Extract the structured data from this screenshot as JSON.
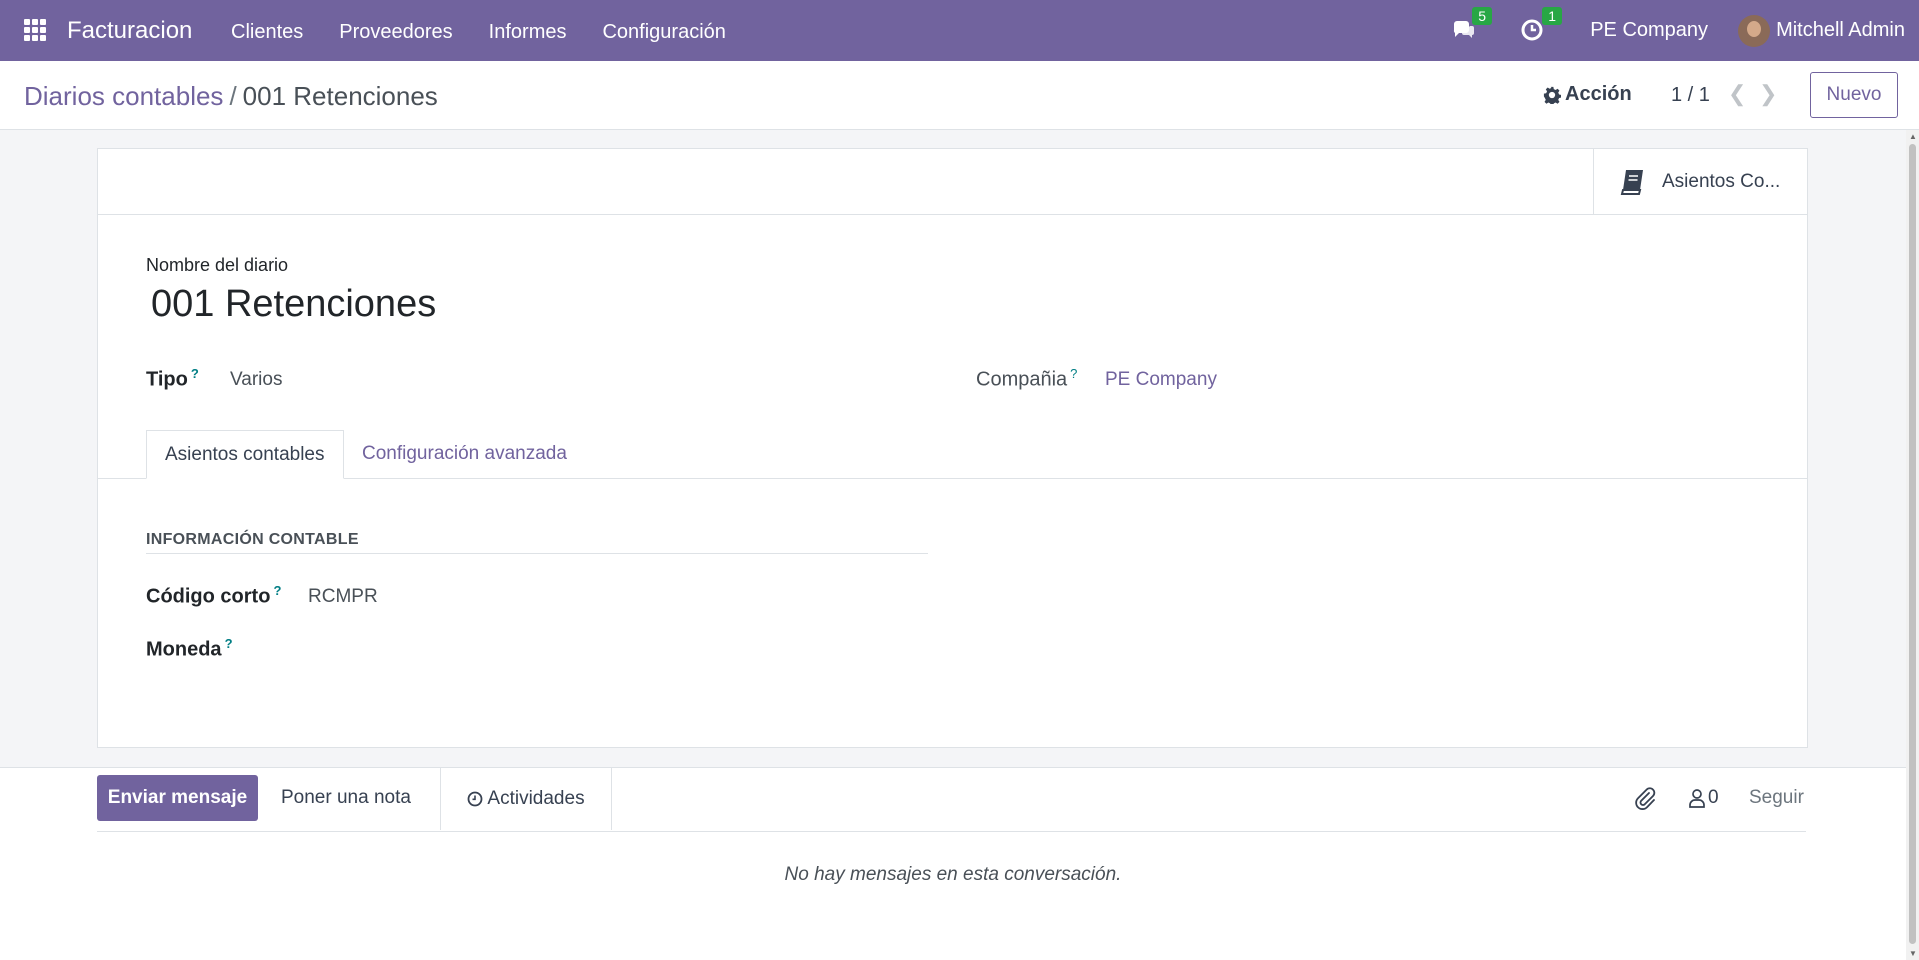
{
  "navbar": {
    "app_name": "Facturacion",
    "menu": [
      "Clientes",
      "Proveedores",
      "Informes",
      "Configuración"
    ],
    "messages_count": "5",
    "activities_count": "1",
    "company": "PE Company",
    "user": "Mitchell Admin",
    "color": "#71639e"
  },
  "breadcrumb": {
    "parent": "Diarios contables",
    "separator": "/",
    "current": "001 Retenciones"
  },
  "control": {
    "action_label": "Acción",
    "pager": "1 / 1",
    "new_label": "Nuevo"
  },
  "smart_button": {
    "label": "Asientos Co..."
  },
  "form": {
    "name_label": "Nombre del diario",
    "name_value": "001 Retenciones",
    "tipo_label": "Tipo",
    "tipo_value": "Varios",
    "company_label": "Compañia",
    "company_value": "PE Company",
    "help_mark": "?"
  },
  "tabs": [
    "Asientos contables",
    "Configuración avanzada"
  ],
  "section": {
    "title": "INFORMACIÓN CONTABLE",
    "code_label": "Código corto",
    "code_value": "RCMPR",
    "currency_label": "Moneda"
  },
  "chatter": {
    "send_label": "Enviar mensaje",
    "note_label": "Poner una nota",
    "activities_label": "Actividades",
    "followers_count": "0",
    "follow_label": "Seguir",
    "empty_text": "No hay mensajes en esta conversación."
  }
}
